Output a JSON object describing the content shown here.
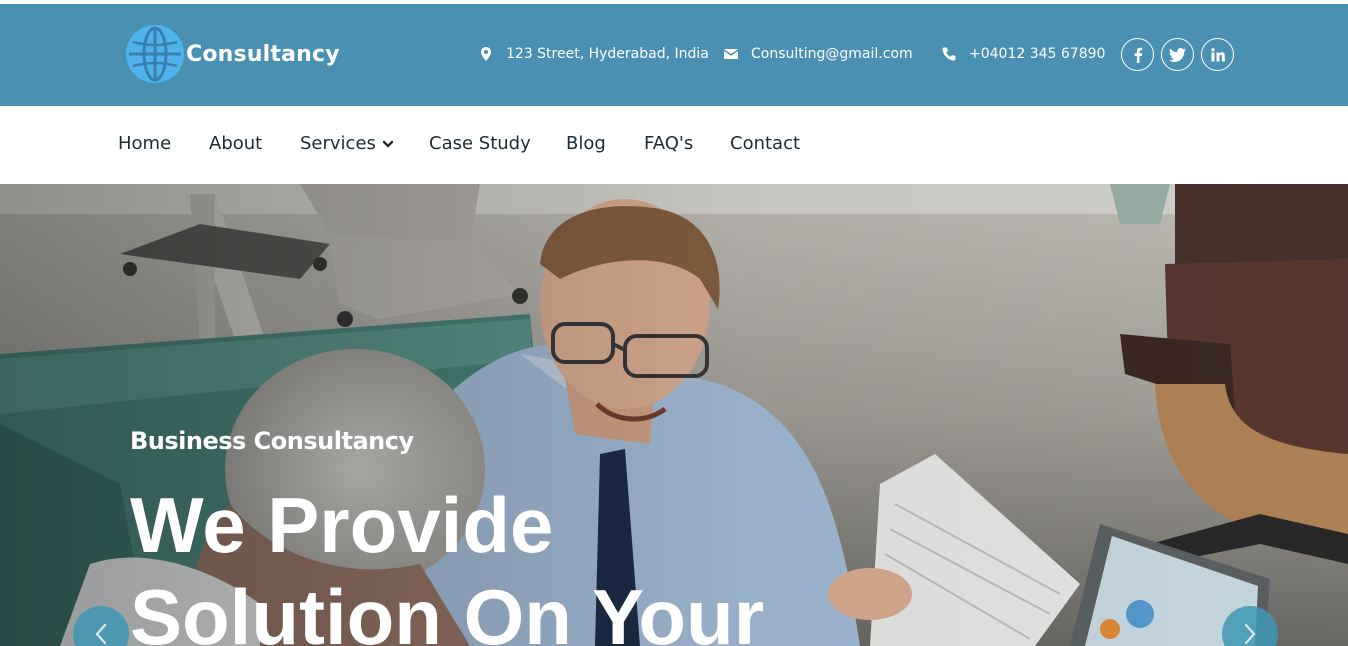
{
  "brand": {
    "name": "Consultancy",
    "icon": "globe-icon",
    "accent": "#4a90b3"
  },
  "topbar": {
    "address": "123 Street, Hyderabad, India",
    "email": "Consulting@gmail.com",
    "phone": "+04012 345 67890",
    "social": [
      {
        "icon": "facebook-icon"
      },
      {
        "icon": "twitter-icon"
      },
      {
        "icon": "linkedin-icon"
      }
    ]
  },
  "nav": {
    "home": "Home",
    "about": "About",
    "services": "Services",
    "case_study": "Case Study",
    "blog": "Blog",
    "faqs": "FAQ's",
    "contact": "Contact"
  },
  "hero": {
    "subtitle": "Business Consultancy",
    "title_line1": "We Provide",
    "title_line2": "Solution On Your"
  }
}
